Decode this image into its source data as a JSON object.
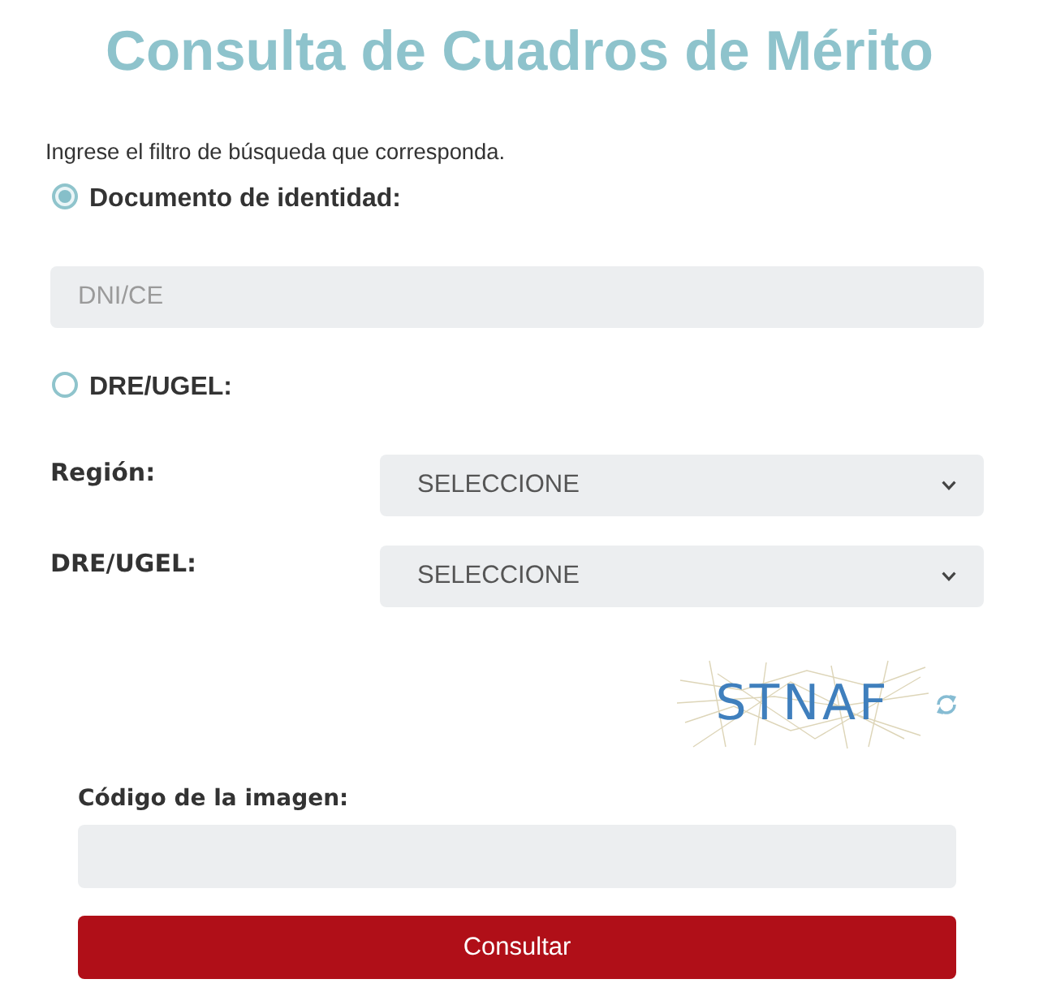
{
  "title": "Consulta de Cuadros de Mérito",
  "instruction": "Ingrese el filtro de búsqueda que corresponda.",
  "filters": [
    {
      "kind": "document",
      "label": "Documento de identidad:",
      "selected": true,
      "field": {
        "placeholder": "DNI/CE"
      }
    },
    {
      "kind": "dre_ugel",
      "label": "DRE/UGEL:",
      "selected": false,
      "selects": [
        {
          "label": "Región:",
          "value": "SELECCIONE"
        },
        {
          "label": "DRE/UGEL:",
          "value": "SELECCIONE"
        }
      ]
    }
  ],
  "captcha": {
    "text": "STNAF"
  },
  "code_field": {
    "label": "Código de la imagen:"
  },
  "submit_button": "Consultar"
}
